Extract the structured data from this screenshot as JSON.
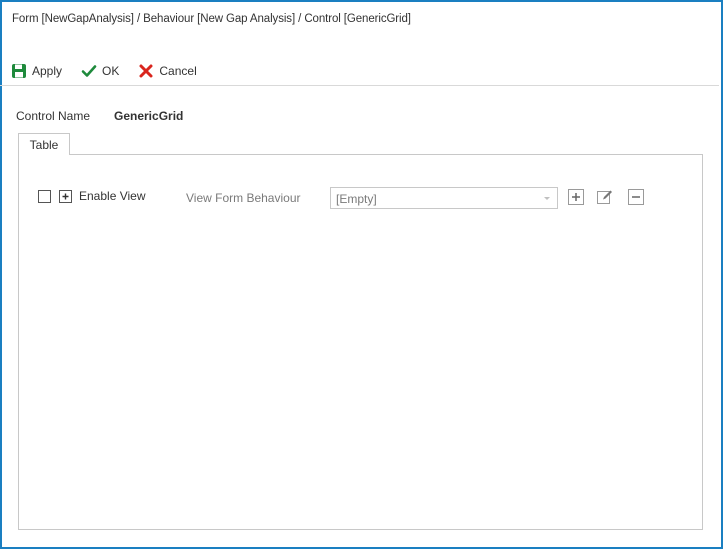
{
  "window": {
    "title": "Form [NewGapAnalysis] / Behaviour [New Gap Analysis] / Control [GenericGrid]"
  },
  "toolbar": {
    "apply_label": "Apply",
    "ok_label": "OK",
    "cancel_label": "Cancel",
    "icons": {
      "apply": "save-icon",
      "ok": "checkmark-icon",
      "cancel": "x-icon"
    },
    "colors": {
      "apply": "#1e8a3c",
      "ok": "#1e8a3c",
      "cancel": "#d9251d"
    }
  },
  "control": {
    "name_label": "Control Name",
    "name_value": "GenericGrid"
  },
  "tabs": [
    {
      "label": "Table",
      "selected": true
    }
  ],
  "table_tab": {
    "enable_view_label": "Enable View",
    "enable_view_checked": false,
    "view_form_behaviour_label": "View Form Behaviour",
    "view_form_behaviour_value": "[Empty]",
    "buttons": [
      "add-icon",
      "edit-icon",
      "remove-icon"
    ]
  }
}
